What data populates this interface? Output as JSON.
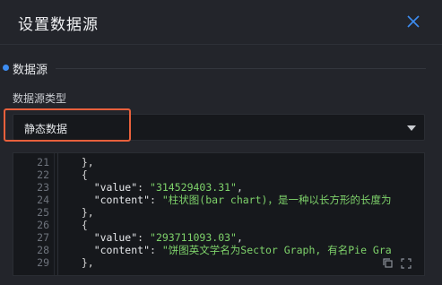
{
  "dialog": {
    "title": "设置数据源",
    "close_icon": "close-icon"
  },
  "section": {
    "label": "数据源"
  },
  "data_source_type": {
    "label": "数据源类型",
    "selected": "静态数据"
  },
  "editor": {
    "lines": [
      {
        "no": "21",
        "text": "  },"
      },
      {
        "no": "22",
        "text": "  {"
      },
      {
        "no": "23",
        "key": "    \"value\"",
        "sep": ": ",
        "val": "\"314529403.31\"",
        "end": ","
      },
      {
        "no": "24",
        "key": "    \"content\"",
        "sep": ": ",
        "val": "\"柱状图(bar chart)，是一种以长方形的长度为",
        "end": ""
      },
      {
        "no": "25",
        "text": "  },"
      },
      {
        "no": "26",
        "text": "  {"
      },
      {
        "no": "27",
        "key": "    \"value\"",
        "sep": ": ",
        "val": "\"293711093.03\"",
        "end": ","
      },
      {
        "no": "28",
        "key": "    \"content\"",
        "sep": ": ",
        "val": "\"饼图英文学名为Sector Graph, 有名Pie Gra",
        "end": ""
      },
      {
        "no": "29",
        "text": "  },"
      }
    ],
    "tools": [
      "copy-icon",
      "fullscreen-icon"
    ]
  },
  "colors": {
    "accent": "#3d8df2",
    "highlight": "#e8603c",
    "string": "#7fd36b"
  }
}
